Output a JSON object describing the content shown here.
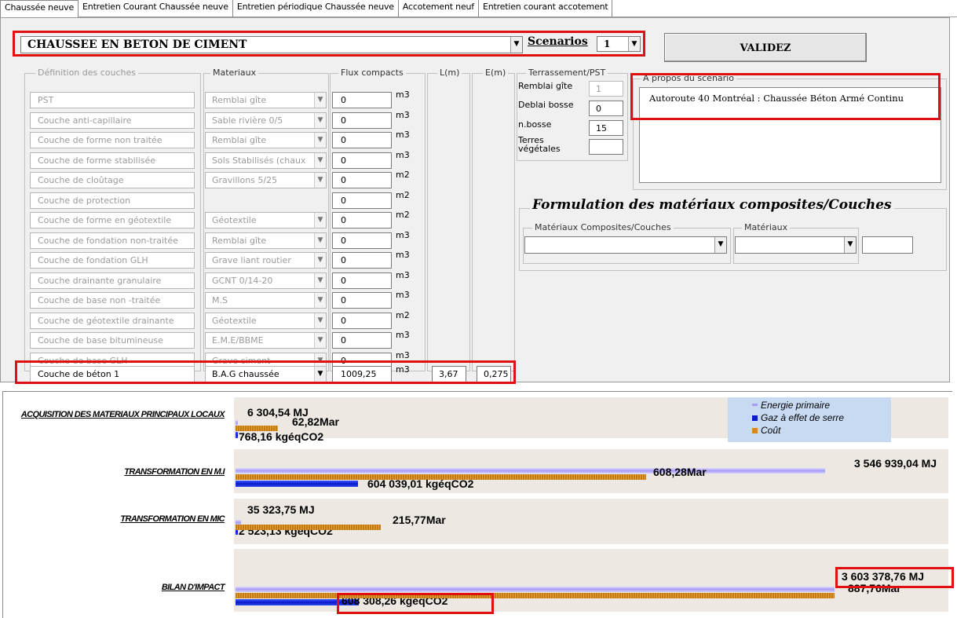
{
  "tabs": [
    "Chaussée neuve",
    "Entretien Courant Chaussée neuve",
    "Entretien périodique Chaussée neuve",
    "Accotement neuf",
    "Entretien courant accotement"
  ],
  "pavement_type": "CHAUSSEE EN BETON DE CIMENT",
  "scenarios_label": "Scenarios",
  "scenario_value": "1",
  "validate_label": "VALIDEZ",
  "headers": {
    "layers": "Définition des couches",
    "materials": "Materiaux",
    "flux": "Flux compacts",
    "L": "L(m)",
    "E": "E(m)",
    "earthworks": "Terrassement/PST",
    "about": "A propos du scénario"
  },
  "layers": [
    {
      "name": "PST",
      "material": "Remblai gîte",
      "flux": "0",
      "unit": "m3"
    },
    {
      "name": "Couche anti-capillaire",
      "material": "Sable rivière 0/5",
      "flux": "0",
      "unit": "m3"
    },
    {
      "name": "Couche de forme non traitée",
      "material": "Remblai gîte",
      "flux": "0",
      "unit": "m3"
    },
    {
      "name": "Couche de forme stabilisée",
      "material": "Sols Stabilisés (chaux",
      "flux": "0",
      "unit": "m3"
    },
    {
      "name": "Couche de cloûtage",
      "material": "Gravillons 5/25",
      "flux": "0",
      "unit": "m2"
    },
    {
      "name": "Couche de protection",
      "material": "",
      "flux": "0",
      "unit": "m2"
    },
    {
      "name": "Couche de forme en géotextile",
      "material": "Géotextile",
      "flux": "0",
      "unit": "m2"
    },
    {
      "name": "Couche de fondation non-traitée",
      "material": "Remblai gîte",
      "flux": "0",
      "unit": "m3"
    },
    {
      "name": "Couche de fondation GLH",
      "material": "Grave liant routier",
      "flux": "0",
      "unit": "m3"
    },
    {
      "name": "Couche drainante granulaire",
      "material": "GCNT 0/14-20",
      "flux": "0",
      "unit": "m3"
    },
    {
      "name": "Couche de base non -traitée",
      "material": "M.S",
      "flux": "0",
      "unit": "m3"
    },
    {
      "name": "Couche de géotextile drainante",
      "material": "Géotextile",
      "flux": "0",
      "unit": "m2"
    },
    {
      "name": "Couche de base bitumineuse",
      "material": "E.M.E/BBME",
      "flux": "0",
      "unit": "m3"
    },
    {
      "name": "Couche de base GLH",
      "material": "Grave ciment",
      "flux": "0",
      "unit": "m3"
    }
  ],
  "beton": {
    "name": "Couche de béton 1",
    "material": "B.A.G chaussée",
    "flux": "1009,25",
    "unit": "m3",
    "L": "3,67",
    "E": "0,275"
  },
  "earthworks": {
    "remblai_label": "Remblai gîte",
    "remblai_value": "1",
    "deblai_label": "Deblai bosse",
    "deblai_value": "0",
    "nbosse_label": "n.bosse",
    "nbosse_value": "15",
    "terres_label1": "Terres",
    "terres_label2": "végétales",
    "terres_value": ""
  },
  "about_text": "Autoroute 40 Montréal : Chaussée Béton Armé Continu",
  "formulation": {
    "title": "Formulation des matériaux composites/Couches",
    "composites_label": "Matériaux Composites/Couches",
    "materials_label": "Matériaux"
  },
  "chart_data": {
    "type": "bar",
    "orientation": "horizontal",
    "categories": [
      "ACQUISITION DES MATERIAUX PRINCIPAUX LOCAUX",
      "TRANSFORMATION EN M.I",
      "TRANSFORMATION EN MIC",
      "BILAN D'IMPACT"
    ],
    "series": [
      {
        "name": "Energie primaire",
        "unit": "MJ",
        "values": [
          6304.54,
          3546939.04,
          35323.75,
          3603378.76
        ],
        "labels": [
          "6 304,54 MJ",
          "3 546 939,04 MJ",
          "35 323,75 MJ",
          "3 603 378,76 MJ"
        ],
        "color": "#a59cf5"
      },
      {
        "name": "Gaz à effet de serre",
        "unit": "kgéqCO2",
        "values": [
          768.16,
          604039.01,
          2523.13,
          608308.26
        ],
        "labels": [
          "768,16 kgéqCO2",
          "604 039,01 kgéqCO2",
          "2 523,13 kgéqCO2",
          "608 308,26 kgéqCO2"
        ],
        "color": "#0a1bc8"
      },
      {
        "name": "Coût",
        "unit": "Mar",
        "values": [
          62.82,
          608.28,
          215.77,
          887.76
        ],
        "labels": [
          "62,82Mar",
          "608,28Mar",
          "215,77Mar",
          "887,76Mar"
        ],
        "color": "#d08a20"
      }
    ],
    "legend_position": "top-right"
  }
}
